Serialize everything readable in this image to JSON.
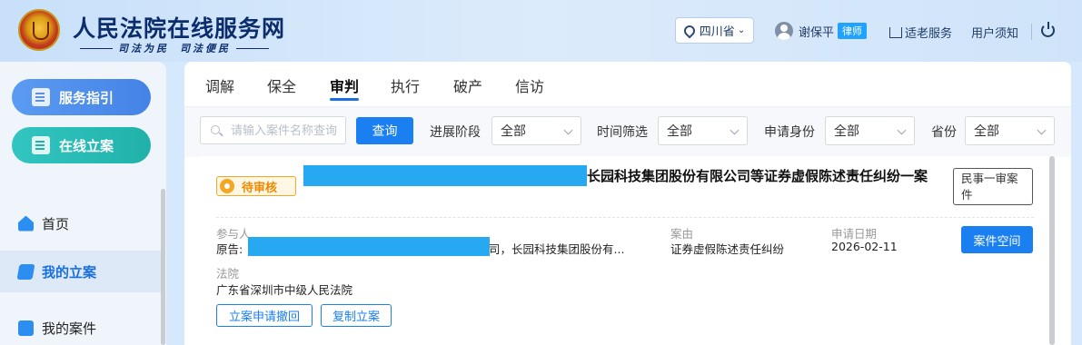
{
  "header": {
    "title": "人民法院在线服务网",
    "slogan_left": "司法为民",
    "slogan_right": "司法便民",
    "province": "四川省",
    "user_name": "谢保平",
    "user_role": "律师",
    "elder_service": "适老服务",
    "user_notice": "用户须知"
  },
  "sidebar": {
    "guide_label": "服务指引",
    "file_label": "在线立案",
    "items": [
      {
        "label": "首页"
      },
      {
        "label": "我的立案"
      },
      {
        "label": "我的案件"
      }
    ]
  },
  "tabs": [
    {
      "label": "调解"
    },
    {
      "label": "保全"
    },
    {
      "label": "审判"
    },
    {
      "label": "执行"
    },
    {
      "label": "破产"
    },
    {
      "label": "信访"
    }
  ],
  "active_tab": "审判",
  "filters": {
    "search_placeholder": "请输入案件名称查询",
    "query_label": "查询",
    "stage_label": "进展阶段",
    "stage_value": "全部",
    "time_label": "时间筛选",
    "time_value": "全部",
    "identity_label": "申请身份",
    "identity_value": "全部",
    "province_label": "省份",
    "province_value": "全部"
  },
  "case": {
    "status": "待审核",
    "title": "长园科技集团股份有限公司等证券虚假陈述责任纠纷一案",
    "type": "民事一审案件",
    "participants_label": "参与人",
    "plaintiff_prefix": "原告:",
    "participants_value": "司，长园科技集团股份有...",
    "cause_label": "案由",
    "cause_value": "证券虚假陈述责任纠纷",
    "date_label": "申请日期",
    "date_value": "2026-02-11",
    "court_label": "法院",
    "court_value": "广东省深圳市中级人民法院",
    "space_button": "案件空间",
    "withdraw_button": "立案申请撤回",
    "copy_button": "复制立案"
  },
  "colors": {
    "primary": "#1a7ff0",
    "status_orange": "#f5a623",
    "redaction": "#26a9f0",
    "brand_navy": "#0b2d6b"
  }
}
